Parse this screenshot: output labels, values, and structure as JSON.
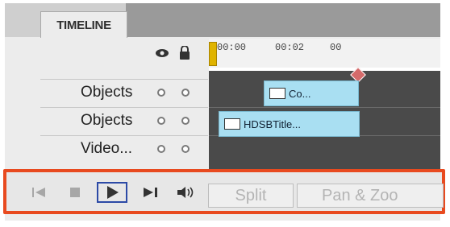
{
  "panel": {
    "tab_label": "TIMELINE"
  },
  "header_icons": {
    "visibility": "eye-icon",
    "lock": "lock-icon"
  },
  "tracks": [
    {
      "label": "Objects"
    },
    {
      "label": "Objects"
    },
    {
      "label": "Video..."
    }
  ],
  "ruler": {
    "labels": [
      "00:00",
      "00:02",
      "00"
    ]
  },
  "clips": [
    {
      "label": "Co..."
    },
    {
      "label": "HDSBTitle..."
    }
  ],
  "transport": {
    "split_label": "Split",
    "pan_label": "Pan & Zoo"
  },
  "colors": {
    "highlight_border": "#e84a1f",
    "clip_fill": "#a9dff2",
    "playhead": "#e0b400",
    "play_button_border": "#2c4aa6"
  }
}
